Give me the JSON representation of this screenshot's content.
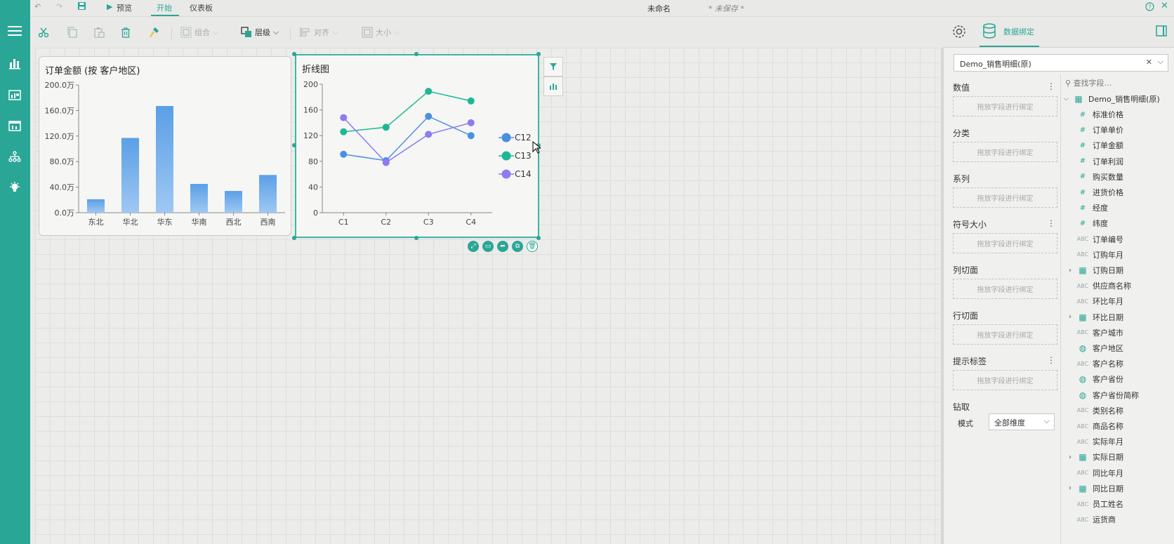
{
  "titlebar": {
    "preview": "预览",
    "tab_start": "开始",
    "tab_dashboard": "仪表板",
    "doc_name": "未命名",
    "unsaved": "* 未保存 *"
  },
  "toolbar": {
    "group": "组合",
    "layer": "层级",
    "align": "对齐",
    "size": "大小"
  },
  "right_header": {
    "tab_binding": "数据绑定"
  },
  "cards": {
    "bar_title": "订单金额 (按 客户地区)",
    "line_title": "折线图"
  },
  "binding": {
    "dataset": "Demo_销售明细(原)",
    "drop_hint": "拖放字段进行绑定",
    "sections": [
      "数值",
      "分类",
      "系列",
      "符号大小",
      "列切面",
      "行切面",
      "提示标签"
    ],
    "drill": "钻取",
    "mode_label": "模式",
    "mode_value": "全部维度"
  },
  "fields": {
    "search_placeholder": "查找字段...",
    "root": "Demo_销售明细(原)",
    "items": [
      {
        "type": "num",
        "label": "标准价格"
      },
      {
        "type": "num",
        "label": "订单单价"
      },
      {
        "type": "num",
        "label": "订单金额"
      },
      {
        "type": "num",
        "label": "订单利润"
      },
      {
        "type": "num",
        "label": "购买数量"
      },
      {
        "type": "num",
        "label": "进货价格"
      },
      {
        "type": "num",
        "label": "经度"
      },
      {
        "type": "num",
        "label": "纬度"
      },
      {
        "type": "abc",
        "label": "订单编号"
      },
      {
        "type": "abc",
        "label": "订购年月"
      },
      {
        "type": "date",
        "label": "订购日期"
      },
      {
        "type": "abc",
        "label": "供应商名称"
      },
      {
        "type": "abc",
        "label": "环比年月"
      },
      {
        "type": "date",
        "label": "环比日期"
      },
      {
        "type": "abc",
        "label": "客户城市"
      },
      {
        "type": "geo",
        "label": "客户地区"
      },
      {
        "type": "abc",
        "label": "客户名称"
      },
      {
        "type": "geo",
        "label": "客户省份"
      },
      {
        "type": "geo",
        "label": "客户省份简称"
      },
      {
        "type": "abc",
        "label": "类别名称"
      },
      {
        "type": "abc",
        "label": "商品名称"
      },
      {
        "type": "abc",
        "label": "实际年月"
      },
      {
        "type": "date",
        "label": "实际日期"
      },
      {
        "type": "abc",
        "label": "同比年月"
      },
      {
        "type": "date",
        "label": "同比日期"
      },
      {
        "type": "abc",
        "label": "员工姓名"
      },
      {
        "type": "abc",
        "label": "运货商"
      }
    ]
  },
  "colors": {
    "accent": "#2aa697",
    "bar": "#5a9fe6",
    "c12": "#4a90e2",
    "c13": "#1cb894",
    "c14": "#8c7cf0"
  },
  "chart_data": [
    {
      "type": "bar",
      "title": "订单金额 (按 客户地区)",
      "categories": [
        "东北",
        "华北",
        "华东",
        "华南",
        "西北",
        "西南"
      ],
      "values": [
        21,
        117,
        167,
        45,
        34,
        59
      ],
      "ylim": [
        0,
        200
      ],
      "yticks": [
        "0.0万",
        "40.0万",
        "80.0万",
        "120.0万",
        "160.0万",
        "200.0万"
      ],
      "ytick_values": [
        0,
        40,
        80,
        120,
        160,
        200
      ]
    },
    {
      "type": "line",
      "title": "折线图",
      "categories": [
        "C1",
        "C2",
        "C3",
        "C4"
      ],
      "ylim": [
        0,
        200
      ],
      "yticks": [
        "0",
        "40",
        "80",
        "120",
        "160",
        "200"
      ],
      "ytick_values": [
        0,
        40,
        80,
        120,
        160,
        200
      ],
      "legend_position": "right",
      "series": [
        {
          "name": "C12",
          "values": [
            91,
            81,
            150,
            120
          ]
        },
        {
          "name": "C13",
          "values": [
            126,
            133,
            189,
            174
          ]
        },
        {
          "name": "C14",
          "values": [
            148,
            78,
            122,
            140
          ]
        }
      ]
    }
  ]
}
